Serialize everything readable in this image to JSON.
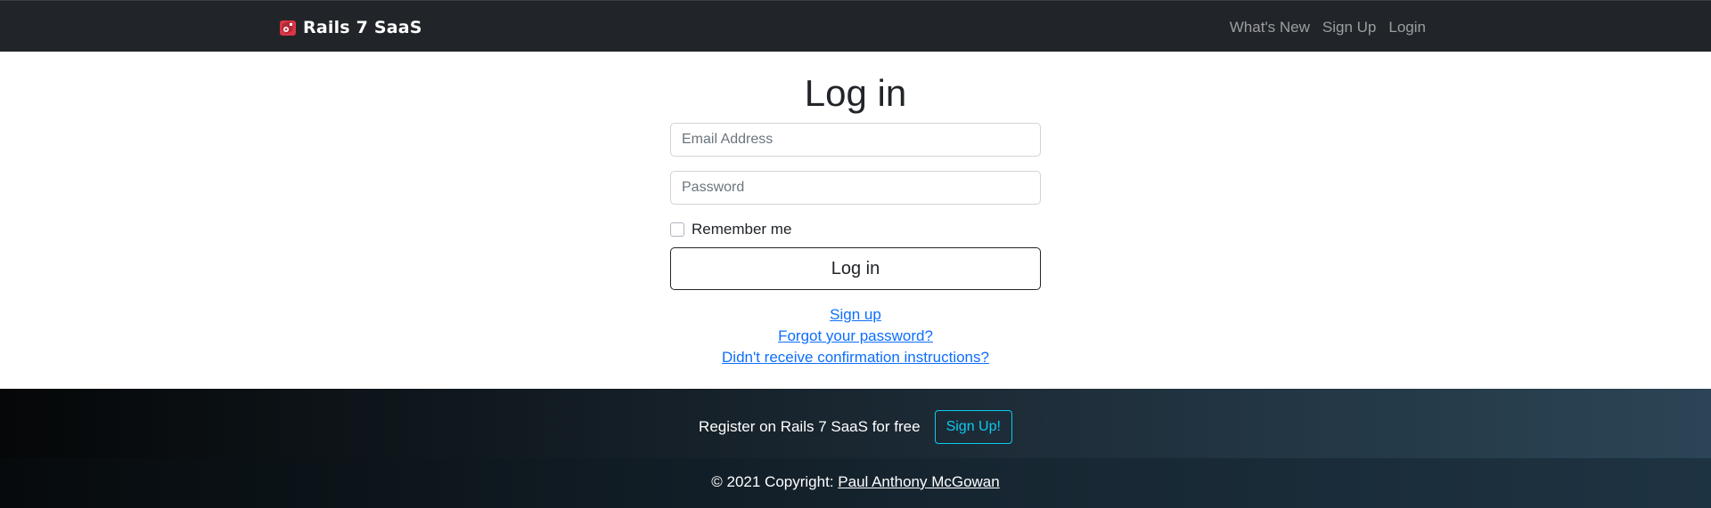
{
  "navbar": {
    "brand": "Rails 7 SaaS",
    "links": [
      "What's New",
      "Sign Up",
      "Login"
    ]
  },
  "form": {
    "title": "Log in",
    "email_placeholder": "Email Address",
    "password_placeholder": "Password",
    "remember_label": "Remember me",
    "submit_label": "Log in"
  },
  "links": [
    "Sign up",
    "Forgot your password?",
    "Didn't receive confirmation instructions?"
  ],
  "footer": {
    "cta_text": "Register on Rails 7 SaaS for free",
    "cta_button": "Sign Up!",
    "copyright_prefix": "© 2021 Copyright:",
    "copyright_name": "Paul Anthony McGowan"
  },
  "colors": {
    "navbar_bg": "#212529",
    "link": "#0d6efd",
    "cta_accent": "#0dcaf0",
    "logo_red": "#dc3545"
  },
  "icons": {
    "brand": "ruby-gem-icon"
  }
}
